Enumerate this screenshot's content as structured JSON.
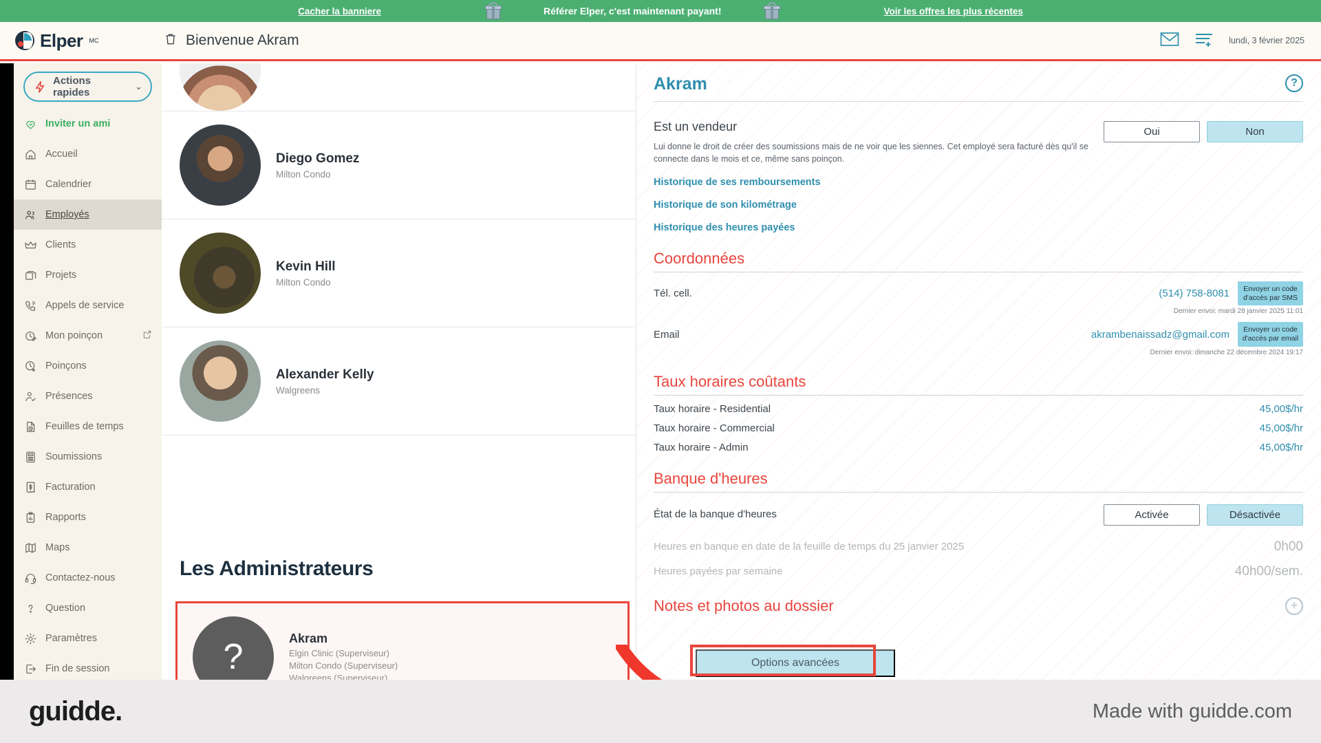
{
  "promo_banner": {
    "hide_link": "Cacher la banniere",
    "message": "Référer Elper, c'est maintenant payant!",
    "offers_link": "Voir les offres les plus récentes",
    "gift_icon": "gift-icon",
    "bg_color": "#4caf72"
  },
  "appbar": {
    "brand_name": "Elper",
    "brand_tm": "MC",
    "page_title": "Bienvenue Akram",
    "trash_icon": "trash-icon",
    "mail_icon": "envelope-icon",
    "list_icon": "list-add-icon",
    "date": "lundi, 3 février 2025"
  },
  "sidebar": {
    "quick_actions": {
      "label": "Actions rapides",
      "icon": "lightning-bolt-icon",
      "chevron": "chevron-down-icon"
    },
    "items": [
      {
        "label": "Inviter un ami",
        "icon": "heart-handshake-icon",
        "state": "invite"
      },
      {
        "label": "Accueil",
        "icon": "home-icon",
        "state": "normal"
      },
      {
        "label": "Calendrier",
        "icon": "calendar-icon",
        "state": "normal"
      },
      {
        "label": "Employés",
        "icon": "users-icon",
        "state": "active"
      },
      {
        "label": "Clients",
        "icon": "crown-icon",
        "state": "normal"
      },
      {
        "label": "Projets",
        "icon": "folders-icon",
        "state": "normal"
      },
      {
        "label": "Appels de service",
        "icon": "phone-call-icon",
        "state": "normal"
      },
      {
        "label": "Mon poinçon",
        "icon": "clock-edit-icon",
        "state": "normal",
        "external": true
      },
      {
        "label": "Poinçons",
        "icon": "clock-down-icon",
        "state": "normal"
      },
      {
        "label": "Présences",
        "icon": "user-check-icon",
        "state": "normal"
      },
      {
        "label": "Feuilles de temps",
        "icon": "file-clock-icon",
        "state": "normal"
      },
      {
        "label": "Soumissions",
        "icon": "calculator-icon",
        "state": "normal"
      },
      {
        "label": "Facturation",
        "icon": "receipt-dollar-icon",
        "state": "normal"
      },
      {
        "label": "Rapports",
        "icon": "clipboard-chart-icon",
        "state": "normal"
      },
      {
        "label": "Maps",
        "icon": "map-icon",
        "state": "normal"
      },
      {
        "label": "Contactez-nous",
        "icon": "headset-icon",
        "state": "normal"
      },
      {
        "label": "Question",
        "icon": "question-mark-icon",
        "state": "normal"
      },
      {
        "label": "Paramètres",
        "icon": "gear-icon",
        "state": "normal"
      },
      {
        "label": "Fin de session",
        "icon": "logout-icon",
        "state": "normal"
      }
    ]
  },
  "employee_list": {
    "partial_top_row": {
      "name": "",
      "company": ""
    },
    "rows": [
      {
        "name": "Diego Gomez",
        "company": "Milton Condo"
      },
      {
        "name": "Kevin Hill",
        "company": "Milton Condo"
      },
      {
        "name": "Alexander Kelly",
        "company": "Walgreens"
      }
    ],
    "admins_title": "Les Administrateurs",
    "admin_card": {
      "avatar_glyph": "?",
      "name": "Akram",
      "roles": [
        "Elgin Clinic (Superviseur)",
        "Milton Condo (Superviseur)",
        "Walgreens (Superviseur)"
      ]
    }
  },
  "detail": {
    "title": "Akram",
    "help_badge": "?",
    "vendeur": {
      "label": "Est un vendeur",
      "description": "Lui donne le droit de créer des soumissions mais de ne voir que les siennes. Cet employé sera facturé dès qu'il se connecte dans le mois et ce, même sans poinçon.",
      "yes_label": "Oui",
      "no_label": "Non",
      "selected": "Non"
    },
    "history_links": [
      "Historique de ses remboursements",
      "Historique de son kilométrage",
      "Historique des heures payées"
    ],
    "coordonnees": {
      "heading": "Coordonnées",
      "phone_label": "Tél. cell.",
      "phone_value": "(514) 758-8081",
      "phone_button": "Envoyer un code d'accès par SMS",
      "phone_note": "Dernier envoi: mardi 28 janvier 2025 11:01",
      "email_label": "Email",
      "email_value": "akrambenaissadz@gmail.com",
      "email_button": "Envoyer un code d'accès par email",
      "email_note": "Dernier envoi: dimanche 22 décembre 2024 19:17"
    },
    "taux_horaires": {
      "heading": "Taux horaires coûtants",
      "rows": [
        {
          "label": "Taux horaire  - Residential",
          "value": "45,00$/hr"
        },
        {
          "label": "Taux horaire  - Commercial",
          "value": "45,00$/hr"
        },
        {
          "label": "Taux horaire  - Admin",
          "value": "45,00$/hr"
        }
      ]
    },
    "banque_heures": {
      "heading": "Banque d'heures",
      "state_label": "État de la banque d'heures",
      "enabled_label": "Activée",
      "disabled_label": "Désactivée",
      "selected": "Désactivée",
      "balance_label": "Heures en banque en date de la feuille de temps du 25 janvier 2025",
      "balance_value": "0h00",
      "weekly_label": "Heures payées par semaine",
      "weekly_value": "40h00/sem."
    },
    "notes": {
      "heading": "Notes et photos au dossier",
      "add_icon": "plus-circle-icon"
    },
    "advanced_button": "Options avancées"
  },
  "footer": {
    "logo": "guidde.",
    "made_with": "Made with guidde.com"
  },
  "colors": {
    "banner_green": "#4caf72",
    "accent_red": "#e8453c",
    "teal": "#2f8fae",
    "light_teal": "#bde4ef",
    "sidebar_bg": "#f7f3ea",
    "navy": "#1d3040"
  }
}
